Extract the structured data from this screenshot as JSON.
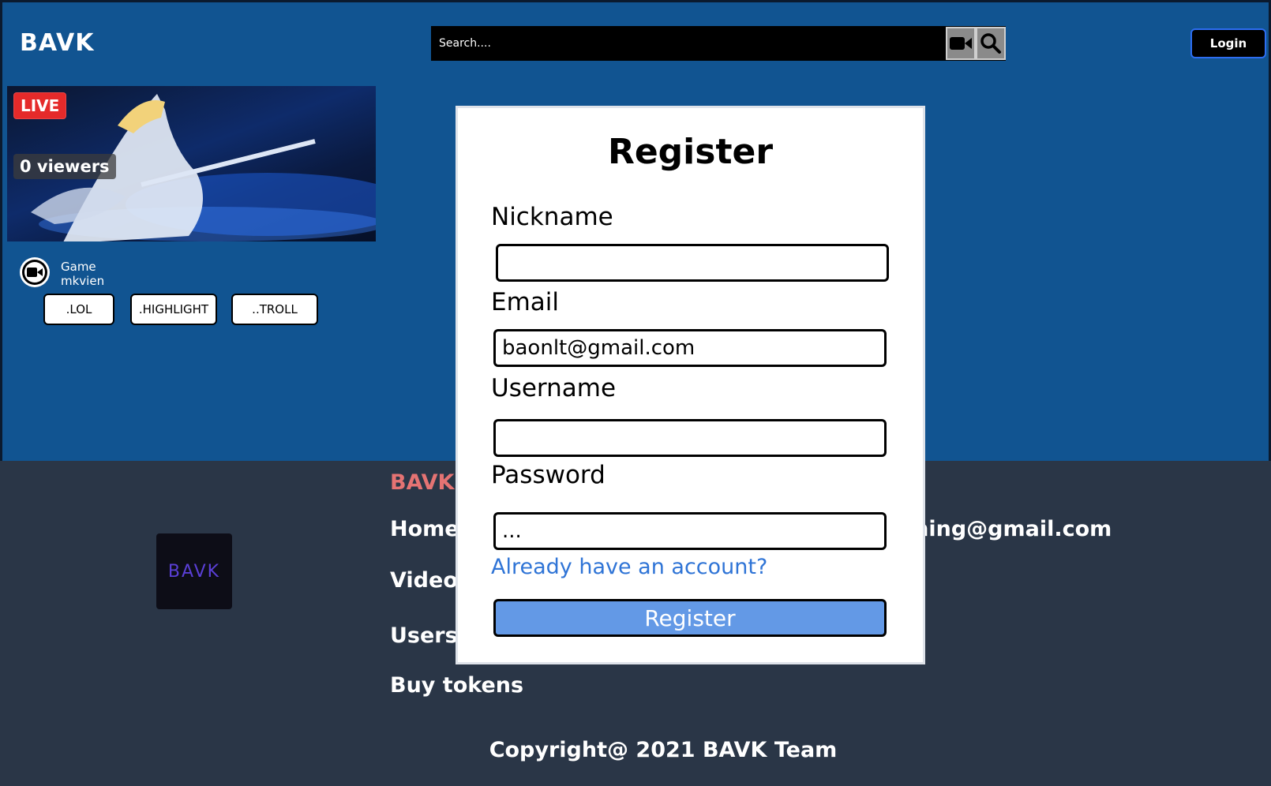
{
  "header": {
    "brand": "BAVK",
    "search_placeholder": "Search....",
    "login_label": "Login"
  },
  "stream_card": {
    "live_badge": "LIVE",
    "viewers": "0 viewers",
    "category": "Game",
    "streamer": "mkvien",
    "tags": [
      ".LOL",
      ".HIGHLIGHT",
      "..TROLL"
    ]
  },
  "footer": {
    "title": "BAVK",
    "logo_text": "BAVK",
    "links": [
      "Home",
      "Videos",
      "Users",
      "Buy tokens"
    ],
    "email": "aming@gmail.com",
    "copyright": "Copyright@ 2021 BAVK Team"
  },
  "modal": {
    "title": "Register",
    "nickname_label": "Nickname",
    "nickname_value": "",
    "email_label": "Email",
    "email_value": "baonlt@gmail.com",
    "username_label": "Username",
    "username_value": "",
    "password_label": "Password",
    "password_value": "...",
    "have_account_link": "Already have an account?",
    "register_button": "Register"
  }
}
